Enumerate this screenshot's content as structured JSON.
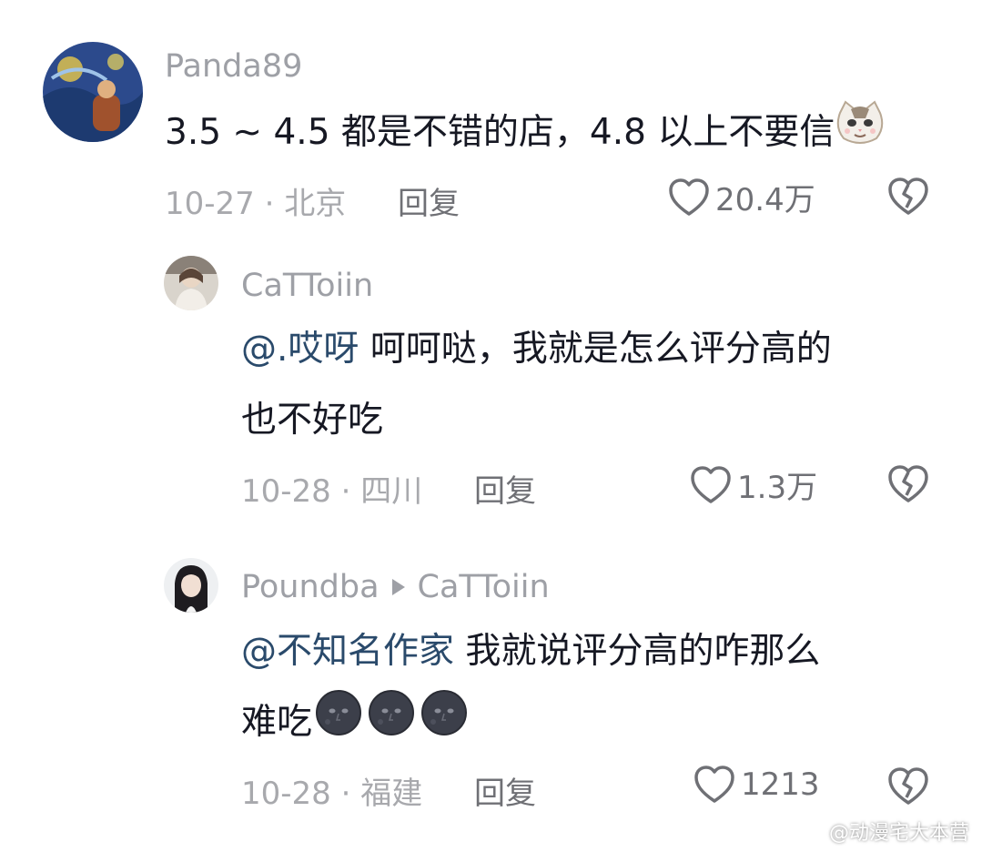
{
  "comments": [
    {
      "username": "Panda89",
      "text": "3.5 ~ 4.5 都是不错的店，4.8 以上不要信",
      "date_location": "10-27 · 北京",
      "reply_label": "回复",
      "likes": "20.4万",
      "emoji": "cat-face-emoji"
    },
    {
      "username": "CaTToiin",
      "mention": "@.哎呀",
      "text_line1": " 呵呵哒，我就是怎么评分高的",
      "text_line2": "也不好吃",
      "date_location": "10-28 · 四川",
      "reply_label": "回复",
      "likes": "1.3万"
    },
    {
      "username": "Poundba",
      "reply_to": "CaTToiin",
      "mention": "@不知名作家",
      "text_line1": " 我就说评分高的咋那么",
      "text_line2": "难吃",
      "emojis": [
        "new-moon-face-emoji",
        "new-moon-face-emoji",
        "new-moon-face-emoji"
      ],
      "date_location": "10-28 · 福建",
      "reply_label": "回复",
      "likes": "1213"
    }
  ],
  "watermark": "@动漫宅大本营",
  "colors": {
    "text": "#161823",
    "username": "#9ea0a6",
    "meta": "#a8a9ad",
    "mention": "#2a4a6b"
  }
}
